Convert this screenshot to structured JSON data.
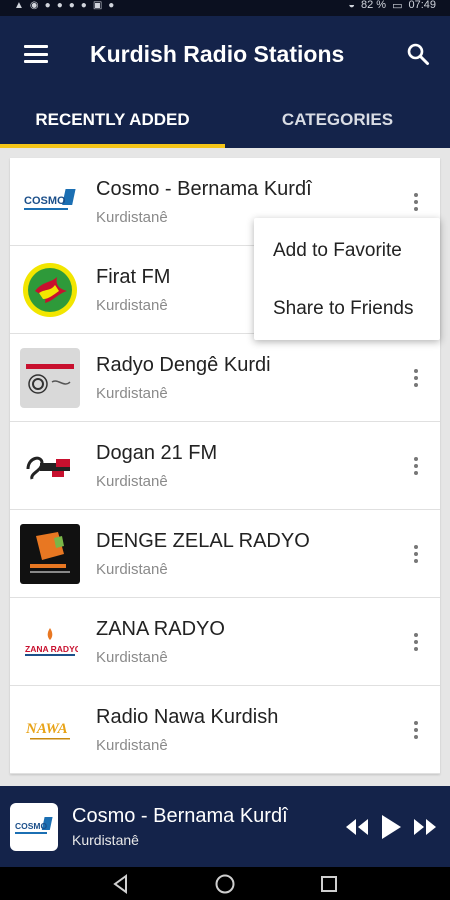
{
  "status_bar": {
    "left_icons": [
      "notification-icons"
    ],
    "battery_text": "82 %",
    "time": "07:49"
  },
  "app_bar": {
    "title": "Kurdish Radio Stations"
  },
  "tabs": [
    {
      "label": "RECENTLY ADDED",
      "active": true
    },
    {
      "label": "CATEGORIES",
      "active": false
    }
  ],
  "stations": [
    {
      "name": "Cosmo - Bernama Kurdî",
      "subtitle": "Kurdistanê",
      "logo_icon": "cosmo-logo",
      "logo_text": "COSMO"
    },
    {
      "name": "Firat FM",
      "subtitle": "Kurdistanê",
      "logo_icon": "firat-fm-logo"
    },
    {
      "name": "Radyo Dengê Kurdi",
      "subtitle": "Kurdistanê",
      "logo_icon": "radyo-denge-kurdi-logo"
    },
    {
      "name": "Dogan 21 FM",
      "subtitle": "Kurdistanê",
      "logo_icon": "dogan-21-fm-logo"
    },
    {
      "name": "DENGE ZELAL RADYO",
      "subtitle": "Kurdistanê",
      "logo_icon": "denge-zelal-logo"
    },
    {
      "name": "ZANA RADYO",
      "subtitle": "Kurdistanê",
      "logo_icon": "zana-radyo-logo",
      "logo_text": "ZANA RADYO"
    },
    {
      "name": "Radio Nawa Kurdish",
      "subtitle": "Kurdistanê",
      "logo_icon": "radio-nawa-logo",
      "logo_text": "NAWA"
    }
  ],
  "popup_menu": {
    "items": [
      "Add to Favorite",
      "Share to Friends"
    ]
  },
  "player": {
    "name": "Cosmo - Bernama Kurdî",
    "subtitle": "Kurdistanê",
    "logo_text": "COSMO"
  },
  "colors": {
    "primary": "#14234a",
    "accent": "#f5c518",
    "background": "#e6e6e6"
  }
}
